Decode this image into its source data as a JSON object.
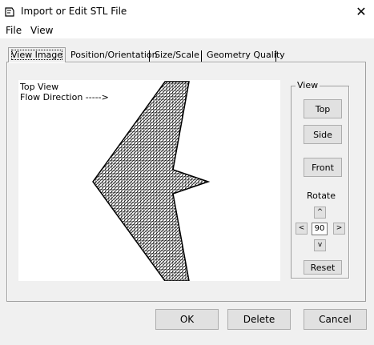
{
  "window": {
    "title": "Import or Edit STL File",
    "close_glyph": "✕"
  },
  "menu": {
    "items": [
      "File",
      "View"
    ]
  },
  "tabs": [
    "View Image",
    "Position/Orientation",
    "Size/Scale",
    "Geometry Quality"
  ],
  "viewport": {
    "line1": "Top View",
    "line2": "Flow Direction ----->"
  },
  "view_group": {
    "label": "View",
    "buttons": {
      "top": "Top",
      "side": "Side",
      "front": "Front"
    },
    "rotate_label": "Rotate",
    "up_arrow": "^",
    "down_arrow": "v",
    "left_arrow": "<",
    "right_arrow": ">",
    "angle": "90",
    "reset": "Reset"
  },
  "footer": {
    "ok": "OK",
    "delete": "Delete",
    "cancel": "Cancel"
  },
  "icons": {
    "app": "stl-file-icon",
    "close": "close-icon"
  }
}
